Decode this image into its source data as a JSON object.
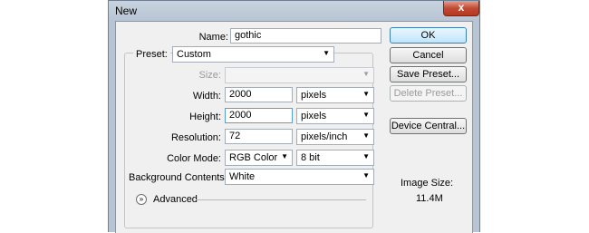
{
  "window": {
    "title": "New",
    "close_glyph": "x"
  },
  "form": {
    "name_label": "Name:",
    "name_value": "gothic",
    "preset_label": "Preset:",
    "preset_value": "Custom",
    "size_label": "Size:",
    "size_value": "",
    "width_label": "Width:",
    "width_value": "2000",
    "width_unit": "pixels",
    "height_label": "Height:",
    "height_value": "2000",
    "height_unit": "pixels",
    "resolution_label": "Resolution:",
    "resolution_value": "72",
    "resolution_unit": "pixels/inch",
    "color_mode_label": "Color Mode:",
    "color_mode_value": "RGB Color",
    "bit_depth_value": "8 bit",
    "background_label": "Background Contents:",
    "background_value": "White",
    "advanced_label": "Advanced"
  },
  "buttons": {
    "ok": "OK",
    "cancel": "Cancel",
    "save_preset": "Save Preset...",
    "delete_preset": "Delete Preset...",
    "device_central": "Device Central..."
  },
  "image_size": {
    "label": "Image Size:",
    "value": "11.4M"
  },
  "icons": {
    "dropdown": "chevron-down-icon",
    "advanced": "expand-chevron-icon",
    "close": "close-icon"
  },
  "colors": {
    "title_bar": "#b7c4d3",
    "client": "#f0f0f0",
    "close_button": "#c24a34",
    "default_button": "#bee6fd"
  }
}
